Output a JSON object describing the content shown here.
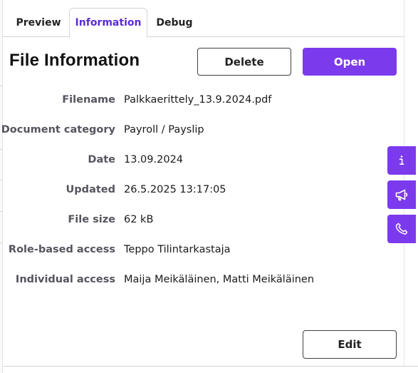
{
  "tabs": [
    {
      "label": "Preview",
      "active": false
    },
    {
      "label": "Information",
      "active": true
    },
    {
      "label": "Debug",
      "active": false
    }
  ],
  "header": {
    "title": "File Information",
    "delete_label": "Delete",
    "open_label": "Open"
  },
  "info": [
    {
      "label": "Filename",
      "value": "Palkkaerittely_13.9.2024.pdf"
    },
    {
      "label": "Document category",
      "value": "Payroll / Payslip"
    },
    {
      "label": "Date",
      "value": "13.09.2024"
    },
    {
      "label": "Updated",
      "value": "26.5.2025 13:17:05"
    },
    {
      "label": "File size",
      "value": "62 kB"
    },
    {
      "label": "Role-based access",
      "value": "Teppo Tilintarkastaja"
    },
    {
      "label": "Individual access",
      "value": "Maija Meikäläinen, Matti Meikäläinen"
    }
  ],
  "footer": {
    "edit_label": "Edit"
  },
  "side_buttons": [
    {
      "icon": "info-icon"
    },
    {
      "icon": "megaphone-icon"
    },
    {
      "icon": "phone-icon"
    }
  ],
  "colors": {
    "accent": "#7c3aed",
    "active_tab_text": "#5b2bd6",
    "label_text": "#55555f"
  }
}
